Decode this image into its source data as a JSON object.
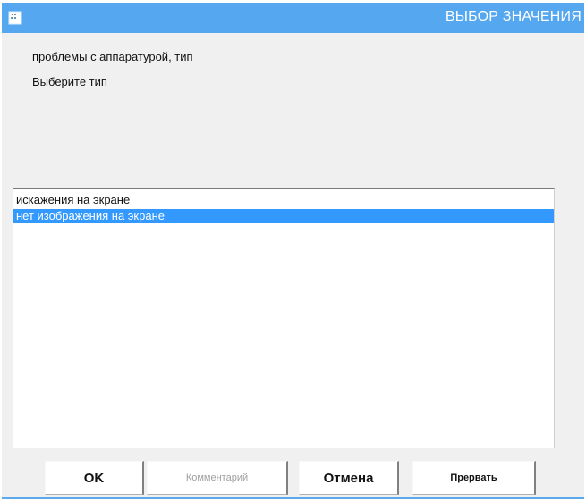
{
  "window": {
    "title": "ВЫБОР ЗНАЧЕНИЯ",
    "icon": "app-menu-icon",
    "titlebar_color": "#55a8f0"
  },
  "prompt": {
    "line1": "проблемы с аппаратурой, тип",
    "line2": "Выберите тип"
  },
  "list": {
    "items": [
      {
        "label": "искажения на экране",
        "selected": false
      },
      {
        "label": "нет изображения на экране",
        "selected": true
      }
    ],
    "selection_color": "#3399ff"
  },
  "buttons": {
    "ok": "OK",
    "comment": "Комментарий",
    "comment_enabled": false,
    "cancel": "Отмена",
    "abort": "Прервать"
  }
}
